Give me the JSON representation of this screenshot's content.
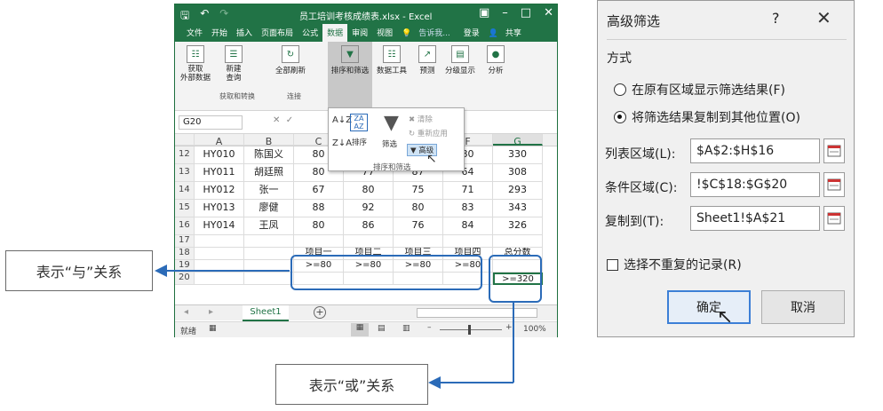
{
  "excel": {
    "title": "员工培训考核成绩表.xlsx - Excel",
    "menu": [
      "文件",
      "开始",
      "插入",
      "页面布局",
      "公式",
      "数据",
      "审阅",
      "视图"
    ],
    "menu_active": "数据",
    "tell_me": "告诉我...",
    "signin": "登录",
    "share": "共享",
    "ribbon": {
      "get_external": "获取\n外部数据",
      "new_query": "新建\n查询",
      "refresh_all": "全部刷新",
      "sort_filter": "排序和筛选",
      "data_tools": "数据工具",
      "forecast": "预测",
      "outline": "分级显示",
      "analysis": "分析",
      "group_get_transform": "获取和转换",
      "group_connections": "连接"
    },
    "popup": {
      "sort": "排序",
      "filter": "筛选",
      "clear": "清除",
      "reapply": "重新应用",
      "advanced": "高级",
      "group_label": "排序和筛选"
    },
    "namebox": "G20",
    "columns": [
      "A",
      "B",
      "C",
      "D",
      "E",
      "F",
      "G"
    ],
    "rows": [
      {
        "n": "12",
        "cells": [
          "HY010",
          "陈国义",
          "80",
          "",
          "",
          "80",
          "330"
        ]
      },
      {
        "n": "13",
        "cells": [
          "HY011",
          "胡廷照",
          "80",
          "77",
          "87",
          "64",
          "308"
        ]
      },
      {
        "n": "14",
        "cells": [
          "HY012",
          "张一",
          "67",
          "80",
          "75",
          "71",
          "293"
        ]
      },
      {
        "n": "15",
        "cells": [
          "HY013",
          "廖健",
          "88",
          "92",
          "80",
          "83",
          "343"
        ]
      },
      {
        "n": "16",
        "cells": [
          "HY014",
          "王凤",
          "80",
          "86",
          "76",
          "84",
          "326"
        ]
      },
      {
        "n": "17",
        "cells": [
          "",
          "",
          "",
          "",
          "",
          "",
          ""
        ]
      },
      {
        "n": "18",
        "cells": [
          "",
          "",
          "项目一",
          "项目二",
          "项目三",
          "项目四",
          "总分数"
        ]
      },
      {
        "n": "19",
        "cells": [
          "",
          "",
          ">=80",
          ">=80",
          ">=80",
          ">=80",
          ""
        ]
      },
      {
        "n": "20",
        "cells": [
          "",
          "",
          "",
          "",
          "",
          "",
          ">=320"
        ]
      }
    ],
    "sheet_tab": "Sheet1",
    "status_ready": "就绪",
    "zoom": "100%"
  },
  "callouts": {
    "and_relation": "表示“与”关系",
    "or_relation": "表示“或”关系"
  },
  "dialog": {
    "title": "高级筛选",
    "help": "?",
    "section": "方式",
    "option1": "在原有区域显示筛选结果(F)",
    "option2": "将筛选结果复制到其他位置(O)",
    "option_selected": 2,
    "list_range_label": "列表区域(L):",
    "list_range_value": "$A$2:$H$16",
    "criteria_range_label": "条件区域(C):",
    "criteria_range_value": "!$C$18:$G$20",
    "copy_to_label": "复制到(T):",
    "copy_to_value": "Sheet1!$A$21",
    "unique_label": "选择不重复的记录(R)",
    "ok": "确定",
    "cancel": "取消"
  },
  "colors": {
    "excel_green": "#217346",
    "highlight_blue": "#2b6bb8"
  }
}
